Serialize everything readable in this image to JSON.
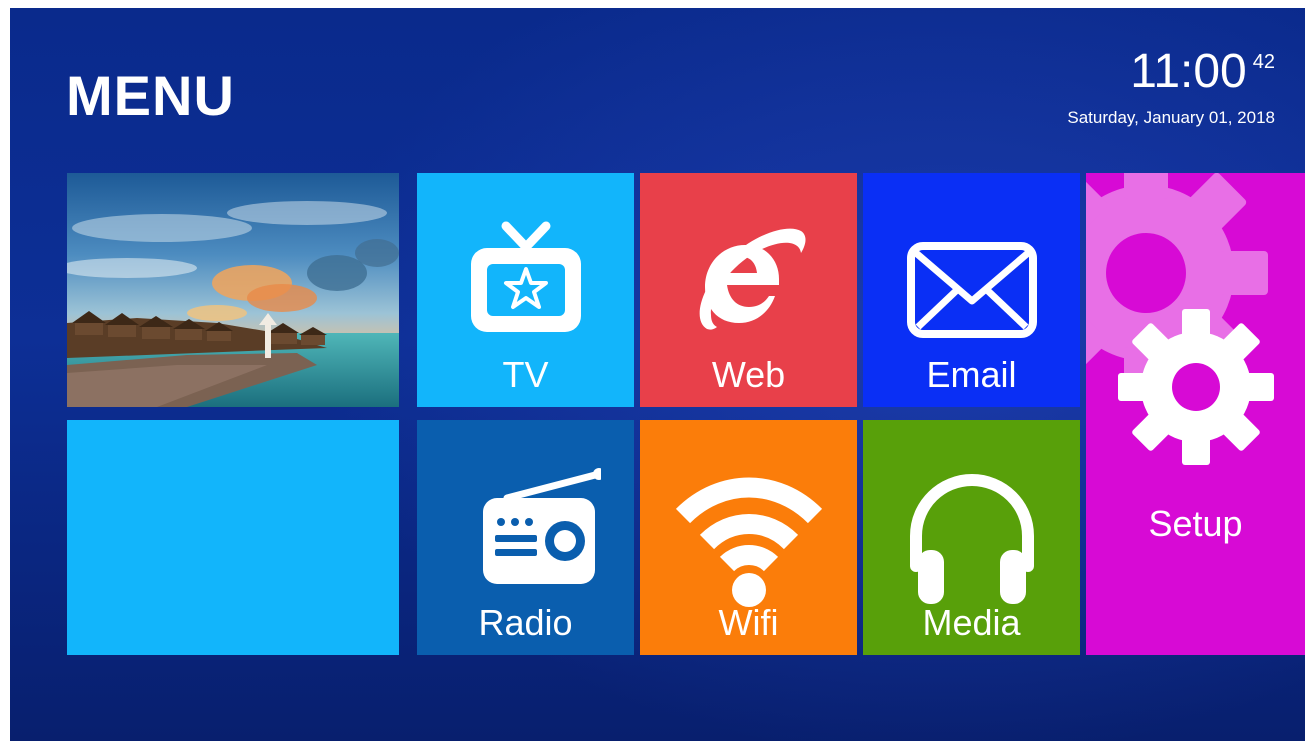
{
  "header": {
    "title": "MENU",
    "time": "11:00",
    "seconds": "42",
    "date": "Saturday, January 01, 2018"
  },
  "tiles": {
    "tv": {
      "label": "TV",
      "color": "#12b5fb",
      "icon": "tv-star-icon"
    },
    "web": {
      "label": "Web",
      "color": "#e8404a",
      "icon": "browser-e-icon"
    },
    "email": {
      "label": "Email",
      "color": "#0a2ff5",
      "icon": "envelope-icon"
    },
    "setup": {
      "label": "Setup",
      "color": "#d70ad5",
      "icon": "gear-icon"
    },
    "radio": {
      "label": "Radio",
      "color": "#0a5eae",
      "icon": "radio-icon"
    },
    "wifi": {
      "label": "Wifi",
      "color": "#fb7d0a",
      "icon": "wifi-icon"
    },
    "media": {
      "label": "Media",
      "color": "#58a00a",
      "icon": "headphones-icon"
    }
  },
  "preview": {
    "image": "beach-resort-sunset-photo",
    "blank_color": "#12b5fb"
  }
}
